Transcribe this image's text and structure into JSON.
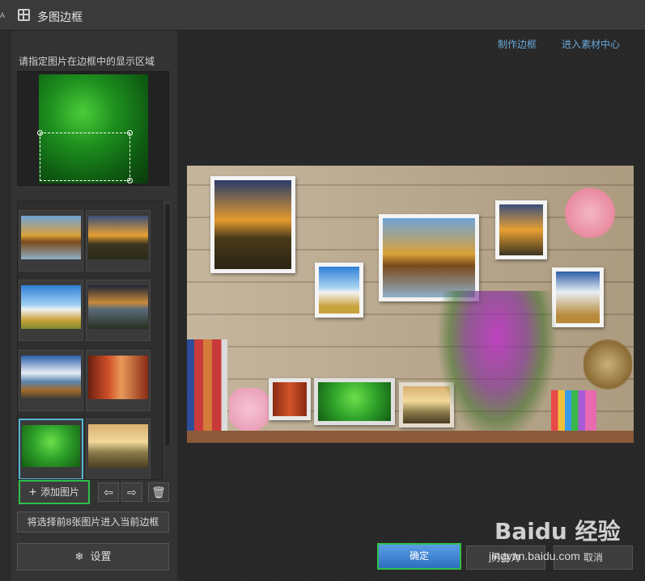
{
  "window": {
    "title": "多图边框",
    "edge_glyph": "A"
  },
  "left_panel": {
    "region_label": "请指定图片在边框中的显示区域",
    "add_button": "添加图片",
    "add_icon": "+",
    "prev_icon": "⇦",
    "next_icon": "⇨",
    "delete_icon": "🗑",
    "apply_button": "将选择前8张图片进入当前边框",
    "settings_icon": "❄",
    "settings_button": "设置"
  },
  "header_links": {
    "make_frame": "制作边框",
    "material_center": "进入素材中心"
  },
  "footer": {
    "ok": "确定",
    "save_as": "另存为",
    "cancel": "取消"
  },
  "watermark": {
    "logo": "Baidu 经验",
    "url": "jingyan.baidu.com"
  },
  "thumbnails": [
    {
      "name": "thumb-autumn-lake",
      "selected": false,
      "gradient": "linear-gradient(#6fa3d8 0%, #d9a23a 45%, #7a4a1a 60%, #8fb0c8 100%)"
    },
    {
      "name": "thumb-sunset-road",
      "selected": false,
      "gradient": "linear-gradient(#3a4f7a 0%, #e7a033 45%, #3d3420 65%, #2a2a1a 100%)"
    },
    {
      "name": "thumb-blue-sky-field",
      "selected": false,
      "gradient": "linear-gradient(#2f7fd6 0%, #9fd0f2 45%, #f0f0f0 55%, #c8a23a 80%, #7a8a2a 100%)"
    },
    {
      "name": "thumb-dusk-lake",
      "selected": false,
      "gradient": "linear-gradient(#1e2436 0%, #c78a3a 40%, #5a6a7a 55%, #27301e 100%)"
    },
    {
      "name": "thumb-clouds-coast",
      "selected": false,
      "gradient": "linear-gradient(#2c5ea8 0%, #e8eef4 40%, #5a84b0 60%, #a36a2a 80%, #3a3a3a 100%)"
    },
    {
      "name": "thumb-red-forest",
      "selected": false,
      "gradient": "linear-gradient(90deg, #6e1e10 0%, #d2542a 35%, #e99a5a 55%, #8a2a14 100%)"
    },
    {
      "name": "thumb-green-plant",
      "selected": true,
      "gradient": "radial-gradient(circle at 50% 40%, #6be04a 0%, #2fa22a 45%, #135c12 100%)"
    },
    {
      "name": "thumb-balloon-valley",
      "selected": false,
      "gradient": "linear-gradient(#d9b070 0%, #f2d89a 40%, #8a7a4a 65%, #4a3c20 100%)"
    }
  ]
}
